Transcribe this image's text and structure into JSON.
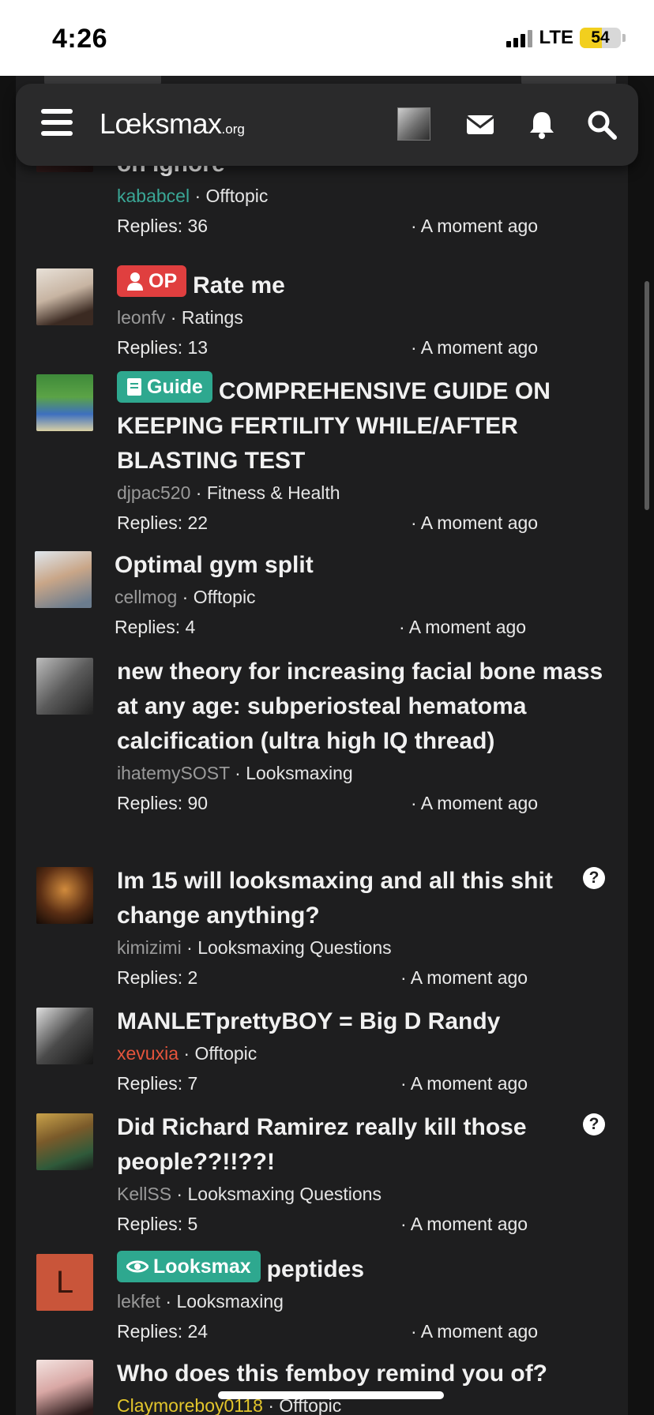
{
  "status_bar": {
    "time": "4:26",
    "network": "LTE",
    "battery_percent": "54",
    "battery_level": 0.54,
    "battery_color": "#f2cf1e"
  },
  "navbar": {
    "logo_main": "Lœksmax",
    "logo_suffix": ".org",
    "icons": [
      "menu-icon",
      "avatar",
      "mail-icon",
      "bell-icon",
      "search-icon"
    ]
  },
  "threads": [
    {
      "title": "on ignore",
      "author": "kababcel",
      "forum": "Offtopic",
      "replies": "Replies: 36",
      "time": "A moment ago"
    },
    {
      "badge": "OP",
      "title": "Rate me",
      "author": "leonfv",
      "forum": "Ratings",
      "replies": "Replies: 13",
      "time": "A moment ago"
    },
    {
      "badge": "Guide",
      "title": "COMPREHENSIVE GUIDE ON KEEPING FERTILITY WHILE/AFTER BLASTING TEST",
      "author": "djpac520",
      "forum": "Fitness & Health",
      "replies": "Replies: 22",
      "time": "A moment ago"
    },
    {
      "title": "Optimal gym split",
      "author": "cellmog",
      "forum": "Offtopic",
      "replies": "Replies: 4",
      "time": "A moment ago"
    },
    {
      "title": "new theory for increasing facial bone mass at any age: subperiosteal hematoma calcification (ultra high IQ thread)",
      "author": "ihatemySOST",
      "forum": "Looksmaxing",
      "replies": "Replies: 90",
      "time": "A moment ago"
    },
    {
      "title": "Im 15 will looksmaxing and all this shit change anything?",
      "author": "kimizimi",
      "forum": "Looksmaxing Questions",
      "replies": "Replies: 2",
      "time": "A moment ago"
    },
    {
      "title": "MANLETprettyBOY = Big D Randy",
      "author": "xevuxia",
      "forum": "Offtopic",
      "replies": "Replies: 7",
      "time": "A moment ago"
    },
    {
      "title": "Did Richard Ramirez really kill those people??!!??!",
      "author": "KellSS",
      "forum": "Looksmaxing Questions",
      "replies": "Replies: 5",
      "time": "A moment ago"
    },
    {
      "badge": "Looksmax",
      "avatar_letter": "L",
      "title": "peptides",
      "author": "lekfet",
      "forum": "Looksmaxing",
      "replies": "Replies: 24",
      "time": "A moment ago"
    },
    {
      "title": "Who does this femboy remind you of?",
      "author": "Claymoreboy0118",
      "forum": "Offtopic"
    }
  ],
  "separator": " · ",
  "question_mark": "?",
  "colors": {
    "background": "#1e1e1f",
    "accent_green": "#2ea88f",
    "op_red": "#e03f3f"
  }
}
